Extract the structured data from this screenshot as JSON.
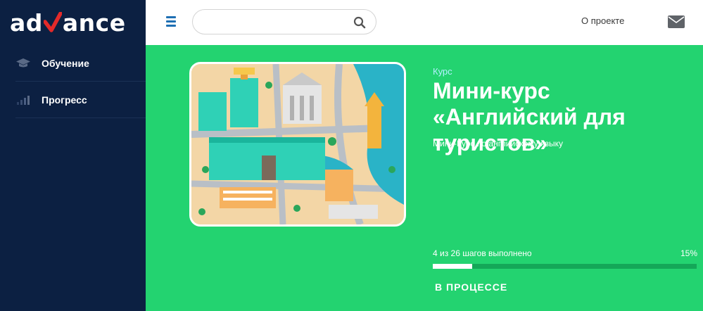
{
  "brand": {
    "logo_left": "ad",
    "logo_right": "ance",
    "accent": "#e42a2a"
  },
  "sidebar": {
    "items": [
      {
        "label": "Обучение",
        "icon": "graduation-cap-icon"
      },
      {
        "label": "Прогресс",
        "icon": "bar-chart-icon"
      }
    ]
  },
  "header": {
    "search_placeholder": "",
    "about_link": "О проекте",
    "menu_icon": "hamburger-menu-icon",
    "mail_icon": "envelope-icon"
  },
  "course": {
    "kind": "Курс",
    "title": "Мини-курс «Английский для туристов»",
    "subtitle": "Мини-Курс по английскому языку",
    "progress_text": "4 из 26 шагов выполнено",
    "progress_percent_label": "15%",
    "progress_fraction": 0.15,
    "status": "В ПРОЦЕССЕ",
    "image": "city-map-illustration"
  },
  "colors": {
    "sidebar": "#0c2042",
    "hero": "#23d370",
    "accent_blue": "#1e6fb3"
  }
}
